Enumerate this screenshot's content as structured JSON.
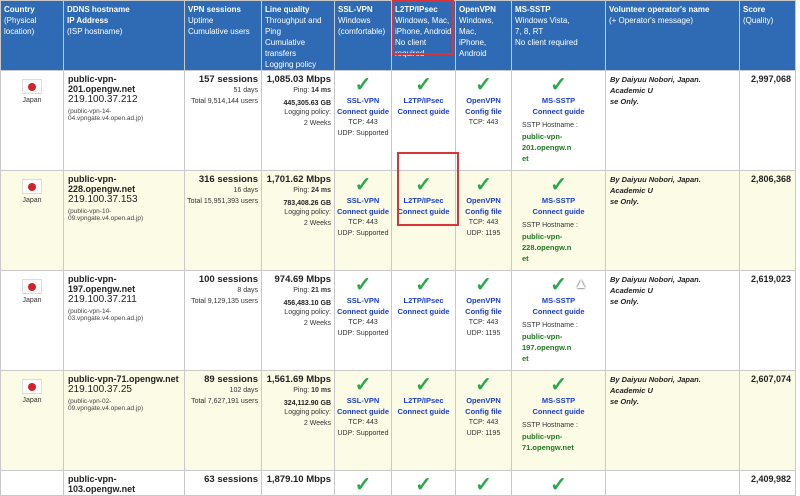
{
  "headers": {
    "country": [
      "Country",
      "(Physical location)"
    ],
    "ddns": [
      "DDNS hostname",
      "IP Address",
      "(ISP hostname)"
    ],
    "sessions": [
      "VPN sessions",
      "Uptime",
      "Cumulative users"
    ],
    "quality": [
      "Line quality",
      "Throughput and Ping",
      "Cumulative transfers",
      "Logging policy"
    ],
    "sslvpn": [
      "SSL-VPN",
      "Windows",
      "(comfortable)"
    ],
    "l2tp": [
      "L2TP/IPsec",
      "Windows, Mac,",
      "iPhone, Android",
      "No client required"
    ],
    "openvpn": [
      "OpenVPN",
      "Windows, Mac,",
      "iPhone, Android"
    ],
    "mssstp": [
      "MS-SSTP",
      "Windows Vista,",
      "7, 8, RT",
      "No client required"
    ],
    "operator": [
      "Volunteer operator's name",
      "(+ Operator's message)"
    ],
    "score": [
      "Score",
      "(Quality)"
    ]
  },
  "labels": {
    "ssl_vpn": "SSL-VPN",
    "l2tp_ipsec": "L2TP/IPsec",
    "openvpn": "OpenVPN",
    "ms_sstp": "MS-SSTP",
    "connect_guide": "Connect guide",
    "config_file": "Config file",
    "sstp_hostname": "SSTP Hostname :",
    "logging_policy": "Logging policy:",
    "check": "✓"
  },
  "rows": [
    {
      "country": "Japan",
      "host": "public-vpn-201.opengw.net",
      "ip": "219.100.37.212",
      "isp": "(public-vpn-14-04.vpngate.v4.open.ad.jp)",
      "sessions": "157 sessions",
      "uptime": "51 days",
      "users": "Total 9,514,144 users",
      "mbps": "1,085.03 Mbps",
      "ping_label": "Ping:",
      "ping": "14 ms",
      "transfer": "445,305.63 GB",
      "policy": "2 Weeks",
      "ssl_tcp": "TCP: 443",
      "ssl_udp": "UDP: Supported",
      "ovpn_tcp": "TCP: 443",
      "ovpn_udp": "",
      "sstp_host": "public-vpn-201.opengw.n",
      "sstp_host2": "et",
      "operator": "By Daiyuu Nobori, Japan. Academic U",
      "operator2": "se Only.",
      "score": "2,997,068"
    },
    {
      "country": "Japan",
      "host": "public-vpn-228.opengw.net",
      "ip": "219.100.37.153",
      "isp": "(public-vpn-10-09.vpngate.v4.open.ad.jp)",
      "sessions": "316 sessions",
      "uptime": "16 days",
      "users": "Total 15,951,393 users",
      "mbps": "1,701.62 Mbps",
      "ping_label": "Ping:",
      "ping": "24 ms",
      "transfer": "783,408.26 GB",
      "policy": "2 Weeks",
      "ssl_tcp": "TCP: 443",
      "ssl_udp": "UDP: Supported",
      "ovpn_tcp": "TCP: 443",
      "ovpn_udp": "UDP: 1195",
      "sstp_host": "public-vpn-228.opengw.n",
      "sstp_host2": "et",
      "operator": "By Daiyuu Nobori, Japan. Academic U",
      "operator2": "se Only.",
      "score": "2,806,368"
    },
    {
      "country": "Japan",
      "host": "public-vpn-197.opengw.net",
      "ip": "219.100.37.211",
      "isp": "(public-vpn-14-03.vpngate.v4.open.ad.jp)",
      "sessions": "100 sessions",
      "uptime": "8 days",
      "users": "Total 9,129,135 users",
      "mbps": "974.69 Mbps",
      "ping_label": "Ping:",
      "ping": "21 ms",
      "transfer": "456,483.10 GB",
      "policy": "2 Weeks",
      "ssl_tcp": "TCP: 443",
      "ssl_udp": "UDP: Supported",
      "ovpn_tcp": "TCP: 443",
      "ovpn_udp": "UDP: 1195",
      "sstp_host": "public-vpn-197.opengw.n",
      "sstp_host2": "et",
      "operator": "By Daiyuu Nobori, Japan. Academic U",
      "operator2": "se Only.",
      "score": "2,619,023"
    },
    {
      "country": "Japan",
      "host": "public-vpn-71.opengw.net",
      "ip": "219.100.37.25",
      "isp": "(public-vpn-02-09.vpngate.v4.open.ad.jp)",
      "sessions": "89 sessions",
      "uptime": "102 days",
      "users": "Total 7,627,191 users",
      "mbps": "1,561.69 Mbps",
      "ping_label": "Ping:",
      "ping": "10 ms",
      "transfer": "324,112.90 GB",
      "policy": "2 Weeks",
      "ssl_tcp": "TCP: 443",
      "ssl_udp": "UDP: Supported",
      "ovpn_tcp": "TCP: 443",
      "ovpn_udp": "UDP: 1195",
      "sstp_host": "public-vpn-71.opengw.net",
      "sstp_host2": "",
      "operator": "By Daiyuu Nobori, Japan. Academic U",
      "operator2": "se Only.",
      "score": "2,607,074"
    },
    {
      "country": "",
      "host": "public-vpn-103.opengw.net",
      "sessions": "63 sessions",
      "mbps": "1,879.10 Mbps",
      "score": "2,409,982"
    }
  ]
}
